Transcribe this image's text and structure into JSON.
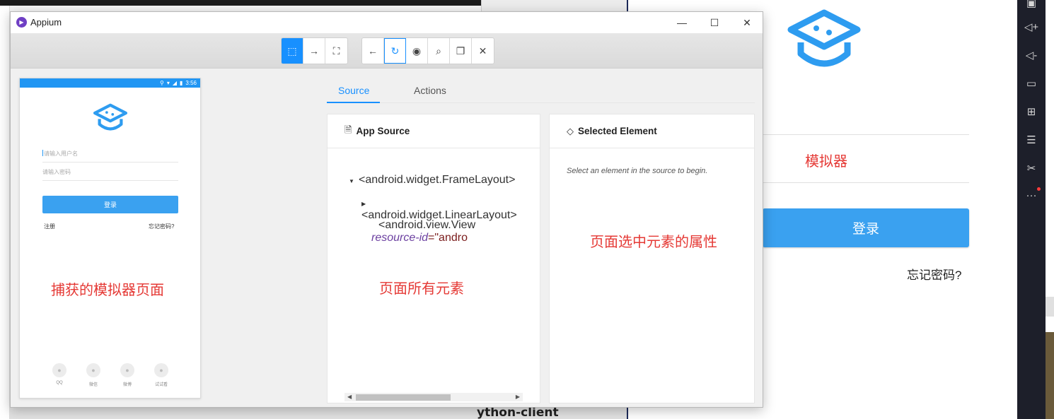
{
  "window": {
    "title": "Appium",
    "controls": {
      "minimize": "—",
      "maximize": "☐",
      "close": "✕"
    }
  },
  "toolbar": {
    "group1": [
      {
        "icon": "select-element-icon",
        "glyph": "⬚",
        "active": true
      },
      {
        "icon": "swipe-arrow-icon",
        "glyph": "→",
        "active": false
      },
      {
        "icon": "tap-coordinates-icon",
        "glyph": "⛶",
        "active": false
      }
    ],
    "group2": [
      {
        "icon": "back-arrow-icon",
        "glyph": "←"
      },
      {
        "icon": "refresh-icon",
        "glyph": "↻"
      },
      {
        "icon": "eye-icon",
        "glyph": "◉"
      },
      {
        "icon": "search-icon",
        "glyph": "⌕"
      },
      {
        "icon": "copy-xml-icon",
        "glyph": "❐"
      },
      {
        "icon": "close-icon",
        "glyph": "✕"
      }
    ]
  },
  "device": {
    "status_time": "3:56",
    "username_placeholder": "请输入用户名",
    "password_placeholder": "请输入密码",
    "login_label": "登录",
    "register_label": "注册",
    "forgot_label": "忘记密码?",
    "social": [
      "QQ",
      "微信",
      "微博",
      "试试看"
    ],
    "annotation": "捕获的模拟器页面"
  },
  "tabs": [
    {
      "label": "Source",
      "active": true
    },
    {
      "label": "Actions",
      "active": false
    }
  ],
  "source_panel": {
    "title": "App Source",
    "tree": [
      {
        "text": "<android.widget.FrameLayout>",
        "depth": 0,
        "caret": "▼"
      },
      {
        "text": "<android.widget.LinearLayout>",
        "depth": 1,
        "caret": "▶"
      },
      {
        "text": "<android.view.View ",
        "attr": "resource-id",
        "value": "=\"andro",
        "depth": 1,
        "caret": ""
      }
    ],
    "annotation": "页面所有元素"
  },
  "selected_panel": {
    "title": "Selected Element",
    "hint": "Select an element in the source to begin.",
    "annotation": "页面选中元素的属性"
  },
  "background": {
    "python_label": "ython-client",
    "emulator_annotation": "模拟器",
    "emulator_login": "登录",
    "emulator_forgot": "忘记密码?",
    "side_tools": [
      "volume-up-icon",
      "volume-down-icon",
      "screen-icon",
      "install-apk-icon",
      "multi-instance-icon",
      "scissors-icon",
      "more-icon"
    ]
  },
  "colors": {
    "accent": "#1890ff",
    "annotation": "#e53935",
    "login_button": "#3aa1f0",
    "status_bar": "#2196f3"
  }
}
